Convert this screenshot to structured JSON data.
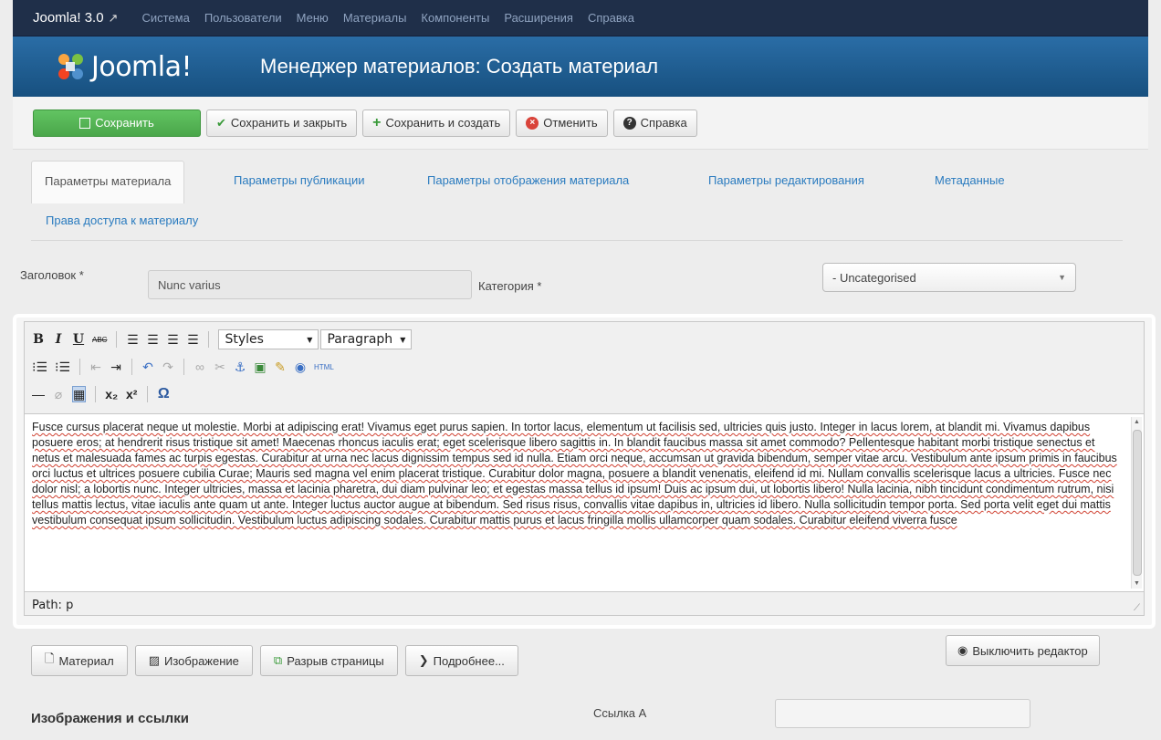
{
  "topnav": {
    "brand": "Joomla! 3.0",
    "menu": [
      "Система",
      "Пользователи",
      "Меню",
      "Материалы",
      "Компоненты",
      "Расширения",
      "Справка"
    ]
  },
  "header": {
    "logo_text": "Joomla!",
    "page_title": "Менеджер материалов: Создать материал"
  },
  "toolbar": {
    "save": "Сохранить",
    "save_close": "Сохранить и закрыть",
    "save_new": "Сохранить и создать",
    "cancel": "Отменить",
    "help": "Справка"
  },
  "tabs": [
    "Параметры материала",
    "Параметры публикации",
    "Параметры отображения материала",
    "Параметры редактирования",
    "Метаданные",
    "Права доступа к материалу"
  ],
  "form": {
    "title_label": "Заголовок *",
    "title_value": "Nunc varius",
    "category_label": "Категория *",
    "category_value": "- Uncategorised"
  },
  "editor": {
    "styles_select": "Styles",
    "format_select": "Paragraph",
    "body": "Fusce cursus placerat neque ut molestie. Morbi at adipiscing erat! Vivamus eget purus sapien. In tortor lacus, elementum ut facilisis sed, ultricies quis justo. Integer in lacus lorem, at blandit mi. Vivamus dapibus posuere eros; at hendrerit risus tristique sit amet! Maecenas rhoncus iaculis erat; eget scelerisque libero sagittis in. In blandit faucibus massa sit amet commodo? Pellentesque habitant morbi tristique senectus et netus et malesuada fames ac turpis egestas. Curabitur at urna nec lacus dignissim tempus sed id nulla. Etiam orci neque, accumsan ut gravida bibendum, semper vitae arcu. Vestibulum ante ipsum primis in faucibus orci luctus et ultrices posuere cubilia Curae; Mauris sed magna vel enim placerat tristique. Curabitur dolor magna, posuere a blandit venenatis, eleifend id mi. Nullam convallis scelerisque lacus a ultricies. Fusce nec dolor nisl; a lobortis nunc. Integer ultricies, massa et lacinia pharetra, dui diam pulvinar leo; et egestas massa tellus id ipsum! Duis ac ipsum dui, ut lobortis libero! Nulla lacinia, nibh tincidunt condimentum rutrum, nisi tellus mattis lectus, vitae iaculis ante quam ut ante. Integer luctus auctor augue at bibendum. Sed risus risus, convallis vitae dapibus in, ultricies id libero. Nulla sollicitudin tempor porta. Sed porta velit eget dui mattis vestibulum consequat ipsum sollicitudin. Vestibulum luctus adipiscing sodales. Curabitur mattis purus et lacus fringilla mollis ullamcorper quam sodales. Curabitur eleifend viverra fusce",
    "path": "Path: p"
  },
  "editor_buttons": {
    "article": "Материал",
    "image": "Изображение",
    "pagebreak": "Разрыв страницы",
    "readmore": "Подробнее...",
    "toggle": "Выключить редактор"
  },
  "images_links": {
    "title": "Изображения и ссылки",
    "link_a_label": "Ссылка A"
  },
  "colors": {
    "topnav_bg": "#1f2f49",
    "header_bg": "#1c5a8f",
    "save_green": "#51b351",
    "link_blue": "#2a7bbf"
  }
}
